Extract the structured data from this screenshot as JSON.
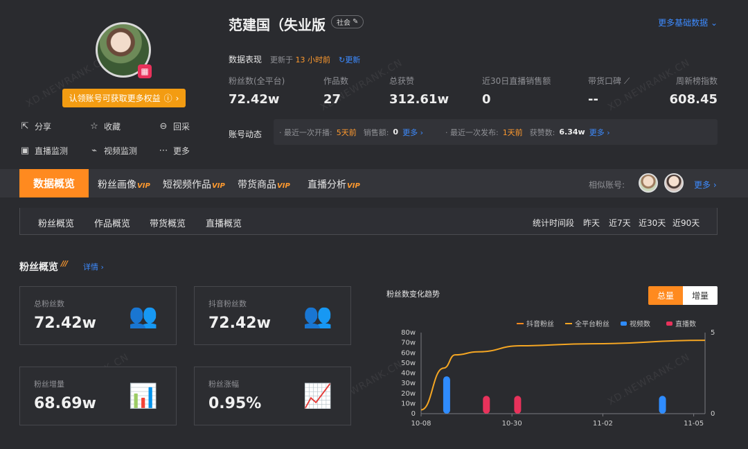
{
  "watermark": "XD.NEWRANK.CN",
  "profile": {
    "claim_label": "认领账号可获取更多权益",
    "actions": [
      {
        "label": "分享",
        "icon": "share-icon"
      },
      {
        "label": "收藏",
        "icon": "star-icon"
      },
      {
        "label": "回采",
        "icon": "recollect-icon"
      },
      {
        "label": "直播监测",
        "icon": "live-monitor-icon"
      },
      {
        "label": "视频监测",
        "icon": "video-monitor-icon"
      },
      {
        "label": "更多",
        "icon": "more-icon"
      }
    ]
  },
  "header": {
    "name": "范建国（失业版",
    "tag": "社会",
    "more_data": "更多基础数据",
    "perf_label": "数据表现",
    "updated_prefix": "更新于",
    "updated_time": "13 小时前",
    "refresh": "更新"
  },
  "stats": [
    {
      "label": "粉丝数(全平台)",
      "value": "72.42w"
    },
    {
      "label": "作品数",
      "value": "27"
    },
    {
      "label": "总获赞",
      "value": "312.61w"
    },
    {
      "label": "近30日直播销售额",
      "value": "0"
    },
    {
      "label": "带货口碑",
      "value": "--"
    },
    {
      "label": "周新榜指数",
      "value": "608.45"
    }
  ],
  "dynamics": {
    "label": "账号动态",
    "live_prefix": "· 最近一次开播:",
    "live_time": "5天前",
    "sales_label": "销售额:",
    "sales_value": "0",
    "more1": "更多",
    "post_prefix": "· 最近一次发布:",
    "post_time": "1天前",
    "likes_label": "获赞数:",
    "likes_value": "6.34w",
    "more2": "更多"
  },
  "tabs": {
    "active": "数据概览",
    "items": [
      {
        "label": "粉丝画像",
        "vip": "VIP"
      },
      {
        "label": "短视频作品",
        "vip": "VIP"
      },
      {
        "label": "带货商品",
        "vip": "VIP"
      },
      {
        "label": "直播分析",
        "vip": "VIP"
      }
    ],
    "similar_label": "相似账号:",
    "similar_more": "更多"
  },
  "subtabs": [
    "粉丝概览",
    "作品概览",
    "带货概览",
    "直播概览"
  ],
  "period": {
    "label": "统计时间段",
    "options": [
      "昨天",
      "近7天",
      "近30天",
      "近90天"
    ],
    "active": "近30天"
  },
  "section": {
    "title": "粉丝概览",
    "detail": "详情"
  },
  "cards": [
    {
      "label": "总粉丝数",
      "value": "72.42w",
      "icon": "users-icon"
    },
    {
      "label": "抖音粉丝数",
      "value": "72.42w",
      "icon": "douyin-users-icon"
    },
    {
      "label": "粉丝增量",
      "value": "68.69w",
      "icon": "bar-up-icon"
    },
    {
      "label": "粉丝涨幅",
      "value": "0.95%",
      "icon": "trend-up-icon"
    }
  ],
  "chart_toggle": {
    "total": "总量",
    "increment": "增量"
  },
  "chart_data": {
    "type": "line",
    "title": "粉丝数变化趋势",
    "x_ticks": [
      "10-08",
      "10-30",
      "11-02",
      "11-05"
    ],
    "y_ticks": [
      "0",
      "10w",
      "20w",
      "30w",
      "40w",
      "50w",
      "60w",
      "70w",
      "80w"
    ],
    "y2_ticks": [
      "0",
      "5"
    ],
    "ylim": [
      0,
      80
    ],
    "y2lim": [
      0,
      5
    ],
    "series": [
      {
        "name": "抖音粉丝",
        "color": "#ff8a1f",
        "type": "line"
      },
      {
        "name": "全平台粉丝",
        "color": "#f5a623",
        "type": "line",
        "x": [
          0,
          0.08,
          0.12,
          0.2,
          0.35,
          0.6,
          1.0
        ],
        "values": [
          3.8,
          45,
          58,
          61,
          67,
          69,
          72.4
        ]
      },
      {
        "name": "视频数",
        "color": "#2f8cff",
        "type": "bar",
        "x": [
          0.09,
          0.85
        ],
        "values": [
          2.3,
          1.1
        ]
      },
      {
        "name": "直播数",
        "color": "#e8325b",
        "type": "bar",
        "x": [
          0.23,
          0.34
        ],
        "values": [
          1.1,
          1.1
        ]
      }
    ]
  }
}
